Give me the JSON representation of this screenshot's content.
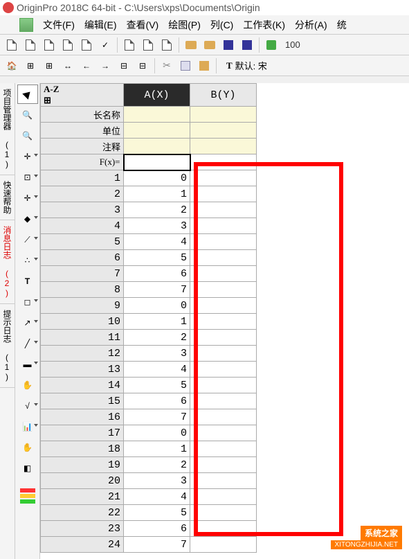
{
  "title": "OriginPro 2018C 64-bit - C:\\Users\\xps\\Documents\\Origin",
  "menu": [
    "文件(F)",
    "编辑(E)",
    "查看(V)",
    "绘图(P)",
    "列(C)",
    "工作表(K)",
    "分析(A)",
    "统"
  ],
  "zoom": "100",
  "font_label": "默认: 宋",
  "side_tabs": [
    {
      "label": "项目管理器 (1)",
      "red": false
    },
    {
      "label": "快速帮助",
      "red": false
    },
    {
      "label": "消息日志 (2)",
      "red": true
    },
    {
      "label": "提示日志 (1)",
      "red": false
    }
  ],
  "sheet": {
    "col_headers": [
      "A(X)",
      "B(Y)"
    ],
    "selected_col": 0,
    "meta_rows": [
      {
        "label": "长名称"
      },
      {
        "label": "单位"
      },
      {
        "label": "注释"
      },
      {
        "label": "F(x)="
      }
    ],
    "rows": [
      {
        "n": 1,
        "a": "0",
        "b": ""
      },
      {
        "n": 2,
        "a": "1",
        "b": ""
      },
      {
        "n": 3,
        "a": "2",
        "b": ""
      },
      {
        "n": 4,
        "a": "3",
        "b": ""
      },
      {
        "n": 5,
        "a": "4",
        "b": ""
      },
      {
        "n": 6,
        "a": "5",
        "b": ""
      },
      {
        "n": 7,
        "a": "6",
        "b": ""
      },
      {
        "n": 8,
        "a": "7",
        "b": ""
      },
      {
        "n": 9,
        "a": "0",
        "b": ""
      },
      {
        "n": 10,
        "a": "1",
        "b": ""
      },
      {
        "n": 11,
        "a": "2",
        "b": ""
      },
      {
        "n": 12,
        "a": "3",
        "b": ""
      },
      {
        "n": 13,
        "a": "4",
        "b": ""
      },
      {
        "n": 14,
        "a": "5",
        "b": ""
      },
      {
        "n": 15,
        "a": "6",
        "b": ""
      },
      {
        "n": 16,
        "a": "7",
        "b": ""
      },
      {
        "n": 17,
        "a": "0",
        "b": ""
      },
      {
        "n": 18,
        "a": "1",
        "b": ""
      },
      {
        "n": 19,
        "a": "2",
        "b": ""
      },
      {
        "n": 20,
        "a": "3",
        "b": ""
      },
      {
        "n": 21,
        "a": "4",
        "b": ""
      },
      {
        "n": 22,
        "a": "5",
        "b": ""
      },
      {
        "n": 23,
        "a": "6",
        "b": ""
      },
      {
        "n": 24,
        "a": "7",
        "b": ""
      }
    ]
  },
  "watermark": {
    "title": "系统之家",
    "sub": "XITONGZHIJIA.NET"
  }
}
